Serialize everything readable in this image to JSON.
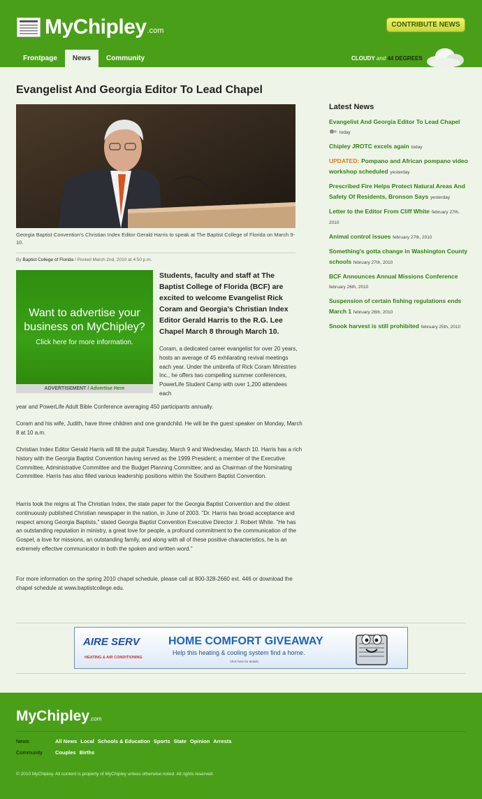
{
  "header": {
    "logo_text": "MyChipley",
    "logo_suffix": ".com",
    "contribute_label": "CONTRIBUTE NEWS",
    "nav": [
      {
        "label": "Frontpage",
        "active": false
      },
      {
        "label": "News",
        "active": true
      },
      {
        "label": "Community",
        "active": false
      }
    ],
    "weather": {
      "condition": "CLOUDY",
      "joiner": "and",
      "temperature": "44 DEGREES",
      "icon": "cloud-icon"
    }
  },
  "article": {
    "title": "Evangelist And Georgia Editor To Lead Chapel",
    "photo_caption": "Georgia Baptist Convention's Christian Index Editor Gerald Harris to speak at The Baptist College of Florida on March 9-10.",
    "byline": {
      "by": "By",
      "author": "Baptist College of Florida",
      "sep": "/",
      "posted": "Posted",
      "date": "March 2nd, 2010 at 4:50 p.m."
    },
    "lead": "Students, faculty and staff at The Baptist College of Florida (BCF) are excited to welcome Evangelist Rick Coram and Georgia's Christian Index Editor Gerald Harris to the R.G. Lee Chapel March 8 through March 10.",
    "para1_part1": "Coram, a dedicated career evangelist for over 20 years, hosts an average of 45 exhilarating revival meetings each year. Under the umbrella of Rick Coram Ministries Inc., he offers two compelling summer conferences, PowerLife Student Camp with over 1,200 attendees each",
    "para1_part2": "year and PowerLife Adult Bible Conference averaging 450 participants annually.",
    "para2": "Coram and his wife, Judith, have three children and one grandchild. He will be the guest speaker on Monday, March 8 at 10 a.m.",
    "para3": "Christian Index Editor Gerald Harris will fill the pulpit Tuesday, March 9 and Wednesday, March 10. Harris has a rich history with the Georgia Baptist Convention having served as the 1999 President; a member of the Executive Committee, Administrative Committee and the Budget Planning Committee; and as Chairman of the Nominating Committee. Harris has also filled various leadership positions within the Southern Baptist Convention.",
    "para4": "Harris took the reigns at The Christian Index, the state paper for the Georgia Baptist Convention and the oldest continuously published Christian newspaper in the nation, in June of 2003. \"Dr. Harris has broad acceptance and respect among Georgia Baptists,\" stated Georgia Baptist Convention Executive Director J. Robert White. \"He has an outstanding reputation in ministry, a great love for people, a profound commitment to the communication of the Gospel, a love for missions, an outstanding family, and along with all of these positive characteristics, he is an extremely effective communicator in both the spoken and written word.\"",
    "para5": "For more information on the spring 2010 chapel schedule, please call at 800-328-2660 ext. 446 or download the chapel schedule at www.baptistcollege.edu."
  },
  "ad": {
    "headline_line1": "Want to advertise your",
    "headline_line2": "business on MyChipley?",
    "sub": "Click here for more information.",
    "label": "ADVERTISEMENT /",
    "link": "Advertise Here"
  },
  "sidebar": {
    "title": "Latest News",
    "items": [
      {
        "prefix": "",
        "title": "Evangelist And Georgia Editor To Lead Chapel",
        "date": "today",
        "has_icon": true
      },
      {
        "prefix": "",
        "title": "Chipley JROTC excels again",
        "date": "today"
      },
      {
        "prefix": "UPDATED:",
        "title": "Pompano and African pompano video workshop scheduled",
        "date": "yesterday"
      },
      {
        "prefix": "",
        "title": "Prescribed Fire Helps Protect Natural Areas And Safety Of Residents, Bronson Says",
        "date": "yesterday"
      },
      {
        "prefix": "",
        "title": "Letter to the Editor From Cliff White",
        "date": "february 27th, 2010"
      },
      {
        "prefix": "",
        "title": "Animal control issues",
        "date": "february 27th, 2010"
      },
      {
        "prefix": "",
        "title": "Something's gotta change in Washington County schools",
        "date": "february 27th, 2010"
      },
      {
        "prefix": "",
        "title": "BCF Announces Annual Missions Conference",
        "date": "february 26th, 2010"
      },
      {
        "prefix": "",
        "title": "Suspension of certain fishing regulations ends March 1",
        "date": "february 26th, 2010"
      },
      {
        "prefix": "",
        "title": "Snook harvest is still prohibited",
        "date": "february 25th, 2010"
      }
    ]
  },
  "banner": {
    "brand": "AIRE SERV",
    "brand_sub": "HEATING & AIR CONDITIONING",
    "headline": "HOME COMFORT GIVEAWAY",
    "sub": "Help this heating & cooling system find a home.",
    "small": "Click here for details."
  },
  "footer": {
    "logo_text": "MyChipley",
    "logo_suffix": ".com",
    "rows": [
      {
        "label": "News",
        "links": [
          "All News",
          "Local",
          "Schools & Education",
          "Sports",
          "State",
          "Opinion",
          "Arrests"
        ]
      },
      {
        "label": "Community",
        "links": [
          "Couples",
          "Births"
        ]
      }
    ],
    "copyright": "© 2010 MyChipley.  All content is property of MyChipley unless otherwise noted. All rights reserved."
  },
  "colors": {
    "brand_green": "#4a9f19",
    "link_green": "#2f7f12",
    "updated_orange": "#e07b12",
    "page_bg": "#eef5e8"
  }
}
